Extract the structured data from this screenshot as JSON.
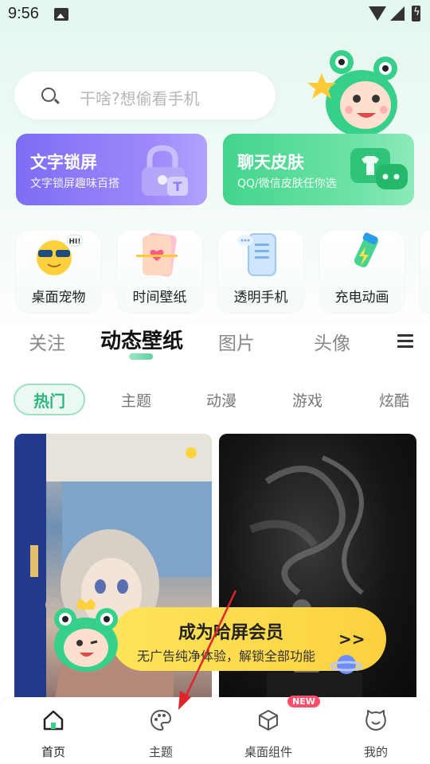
{
  "status_bar": {
    "time": "9:56"
  },
  "search": {
    "placeholder": "干啥?想偷看手机"
  },
  "promos": [
    {
      "title": "文字锁屏",
      "subtitle": "文字锁屏趣味百搭"
    },
    {
      "title": "聊天皮肤",
      "subtitle": "QQ/微信皮肤任你选"
    }
  ],
  "features": [
    {
      "label": "桌面宠物"
    },
    {
      "label": "时间壁纸"
    },
    {
      "label": "透明手机"
    },
    {
      "label": "充电动画"
    }
  ],
  "main_tabs": [
    {
      "label": "关注"
    },
    {
      "label": "动态壁纸",
      "active": true
    },
    {
      "label": "图片"
    },
    {
      "label": "头像"
    }
  ],
  "chips": [
    {
      "label": "热门",
      "active": true
    },
    {
      "label": "主题"
    },
    {
      "label": "动漫"
    },
    {
      "label": "游戏"
    },
    {
      "label": "炫酷"
    }
  ],
  "vip_banner": {
    "title": "成为哈屏会员",
    "subtitle": "无广告纯净体验，解锁全部功能",
    "arrow": ">>"
  },
  "bottom_nav": [
    {
      "label": "首页",
      "icon": "home-icon",
      "active": true
    },
    {
      "label": "主题",
      "icon": "palette-icon"
    },
    {
      "label": "桌面组件",
      "icon": "cube-icon",
      "badge": "NEW"
    },
    {
      "label": "我的",
      "icon": "face-icon"
    }
  ],
  "colors": {
    "accent": "#2fb57e",
    "promo_purple": "#8b7bf6",
    "promo_green": "#4fd893",
    "vip_yellow": "#fde04f",
    "badge_red": "#ff4e6a"
  }
}
